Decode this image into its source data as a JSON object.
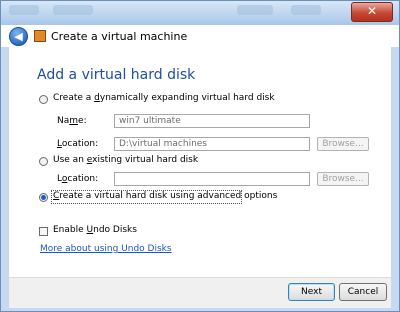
{
  "window": {
    "title": "Create a virtual machine",
    "close_glyph": "✕",
    "back_glyph": "◀",
    "back_icon": "back-arrow-icon",
    "app_icon": "virtual-machine-icon"
  },
  "page": {
    "heading": "Add a virtual hard disk",
    "option_dynamic": {
      "pre": "Create a ",
      "mn": "d",
      "post": "ynamically expanding virtual hard disk"
    },
    "name_label": {
      "pre": "Na",
      "mn": "m",
      "post": "e:"
    },
    "name_value": "win7 ultimate",
    "location_label": {
      "pre": "",
      "mn": "L",
      "post": "ocation:"
    },
    "location_value": "D:\\virtual machines",
    "browse_label": "Browse...",
    "option_existing": {
      "pre": "Use an ",
      "mn": "e",
      "post": "xisting virtual hard disk"
    },
    "location2_label": {
      "pre": "L",
      "mn": "o",
      "post": "cation:"
    },
    "browse2_label": "Browse...",
    "option_advanced": {
      "pre": "",
      "mn": "C",
      "post": "reate a virtual hard disk using advanced options"
    },
    "undo_label": {
      "pre": "Enable ",
      "mn": "U",
      "post": "ndo Disks"
    },
    "undo_link": "More about using Undo Disks"
  },
  "footer": {
    "next_label": "Next",
    "cancel_label": "Cancel"
  },
  "colors": {
    "heading": "#1f4fa0",
    "link": "#1a56c0",
    "close": "#c64a36"
  }
}
